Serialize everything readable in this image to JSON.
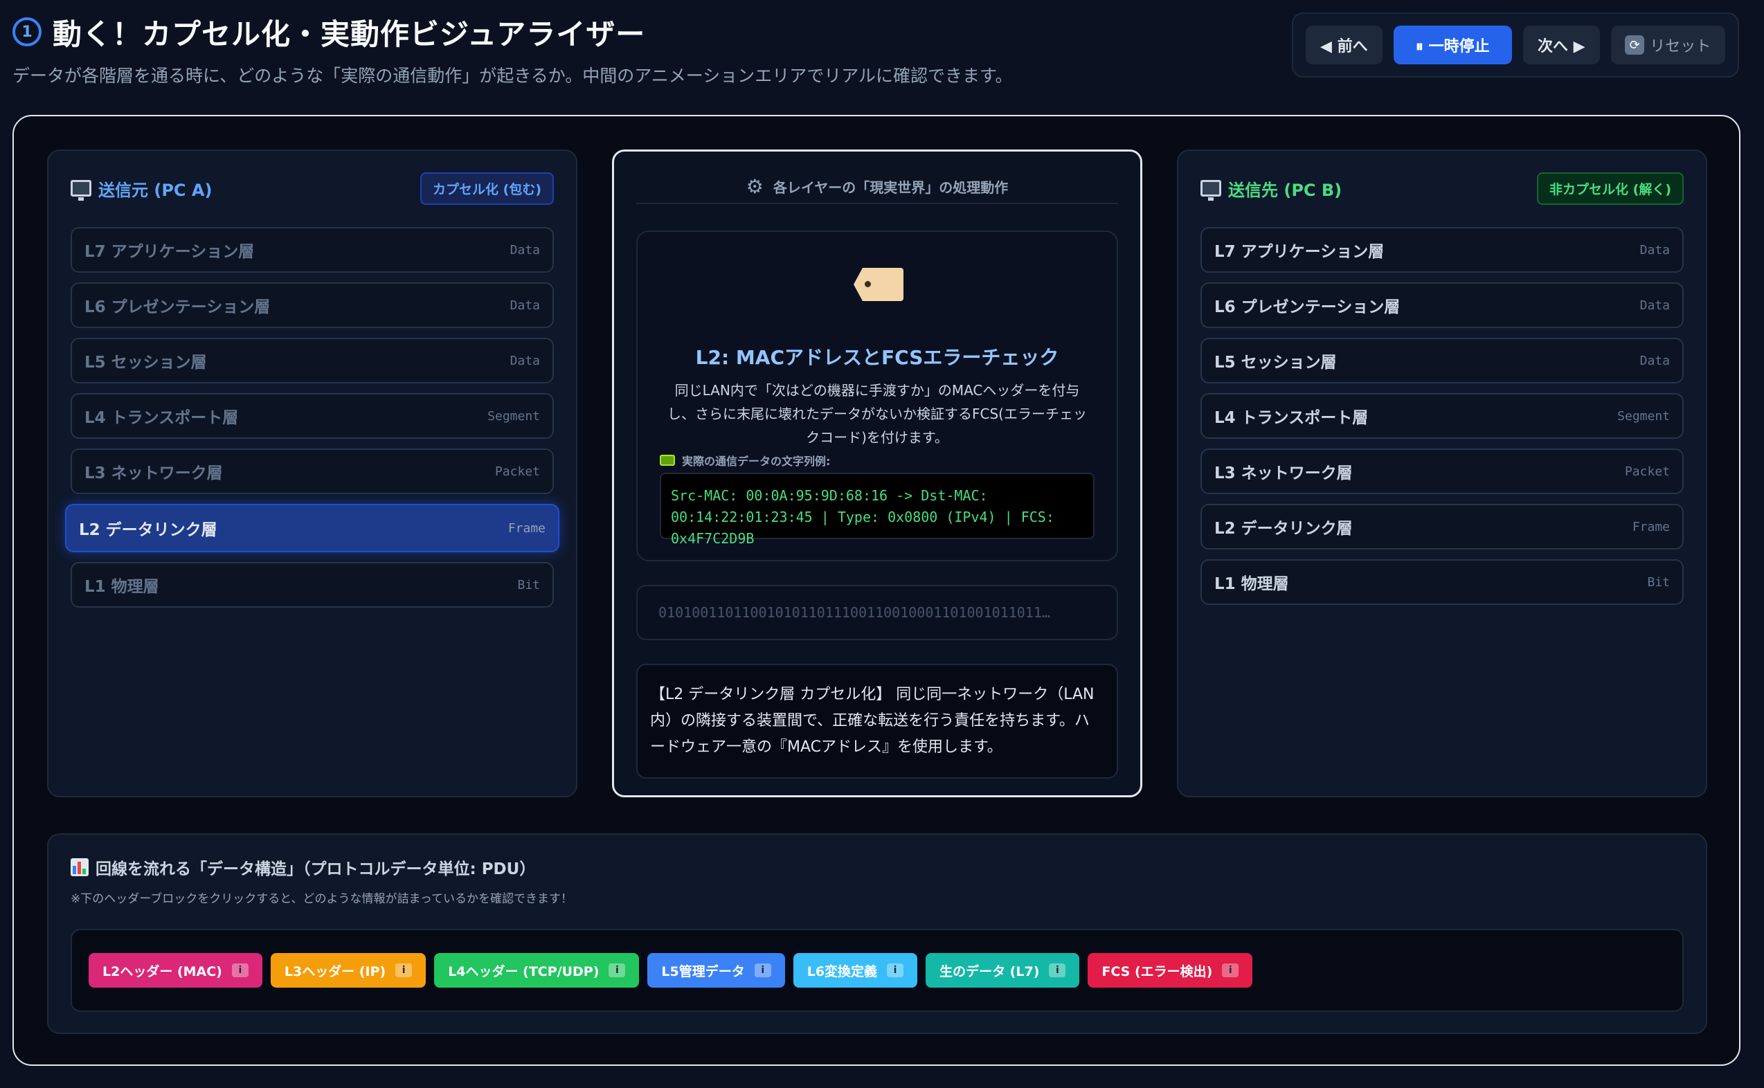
{
  "header": {
    "step": "1",
    "title": "動く！カプセル化・実動作ビジュアライザー",
    "subtitle": "データが各階層を通る時に、どのような「実際の通信動作」が起きるか。中間のアニメーションエリアでリアルに確認できます。"
  },
  "controls": {
    "prev": "◀ 前へ",
    "pause": "⏸ 一時停止",
    "next": "次へ ▶",
    "reset": "リセット"
  },
  "sender": {
    "title": "送信元 (PC A)",
    "mode": "カプセル化 (包む)",
    "layers": [
      {
        "name": "L7 アプリケーション層",
        "pdu": "Data"
      },
      {
        "name": "L6 プレゼンテーション層",
        "pdu": "Data"
      },
      {
        "name": "L5 セッション層",
        "pdu": "Data"
      },
      {
        "name": "L4 トランスポート層",
        "pdu": "Segment"
      },
      {
        "name": "L3 ネットワーク層",
        "pdu": "Packet"
      },
      {
        "name": "L2 データリンク層",
        "pdu": "Frame"
      },
      {
        "name": "L1 物理層",
        "pdu": "Bit"
      }
    ],
    "active_layer": "L2 データリンク層"
  },
  "receiver": {
    "title": "送信先 (PC B)",
    "mode": "非カプセル化 (解く)",
    "layers": [
      {
        "name": "L7 アプリケーション層",
        "pdu": "Data"
      },
      {
        "name": "L6 プレゼンテーション層",
        "pdu": "Data"
      },
      {
        "name": "L5 セッション層",
        "pdu": "Data"
      },
      {
        "name": "L4 トランスポート層",
        "pdu": "Segment"
      },
      {
        "name": "L3 ネットワーク層",
        "pdu": "Packet"
      },
      {
        "name": "L2 データリンク層",
        "pdu": "Frame"
      },
      {
        "name": "L1 物理層",
        "pdu": "Bit"
      }
    ]
  },
  "center": {
    "heading": "各レイヤーの「現実世界」の処理動作",
    "stage_title": "L2: MACアドレスとFCSエラーチェック",
    "stage_desc": "同じLAN内で「次はどの機器に手渡すか」のMACヘッダーを付与し、さらに末尾に壊れたデータがないか検証するFCS(エラーチェックコード)を付けます。",
    "sample_label": "実際の通信データの文字列例:",
    "sample_code": "Src-MAC: 00:0A:95:9D:68:16 -> Dst-MAC: 00:14:22:01:23:45 | Type: 0x0800 (IPv4) | FCS: 0x4F7C2D9B",
    "bits": "0101001101100101011011100110010001101001011011…",
    "note": "【L2 データリンク層 カプセル化】 同じ同一ネットワーク（LAN内）の隣接する装置間で、正確な転送を行う責任を持ちます。ハードウェア一意の『MACアドレス』を使用します。"
  },
  "pdu": {
    "title": "回線を流れる「データ構造」（プロトコルデータ単位: PDU）",
    "hint": "※下のヘッダーブロックをクリックすると、どのような情報が詰まっているかを確認できます！",
    "blocks": [
      {
        "label": "L2ヘッダー (MAC)",
        "color": "#db2777"
      },
      {
        "label": "L3ヘッダー (IP)",
        "color": "#f59e0b"
      },
      {
        "label": "L4ヘッダー (TCP/UDP)",
        "color": "#22c55e"
      },
      {
        "label": "L5管理データ",
        "color": "#3b82f6"
      },
      {
        "label": "L6変換定義",
        "color": "#38bdf8"
      },
      {
        "label": "生のデータ (L7)",
        "color": "#14b8a6"
      },
      {
        "label": "FCS (エラー検出)",
        "color": "#e11d48"
      }
    ]
  },
  "colors": {
    "accent": "#2563eb",
    "sender": "#60a5fa",
    "receiver": "#4ade80"
  }
}
